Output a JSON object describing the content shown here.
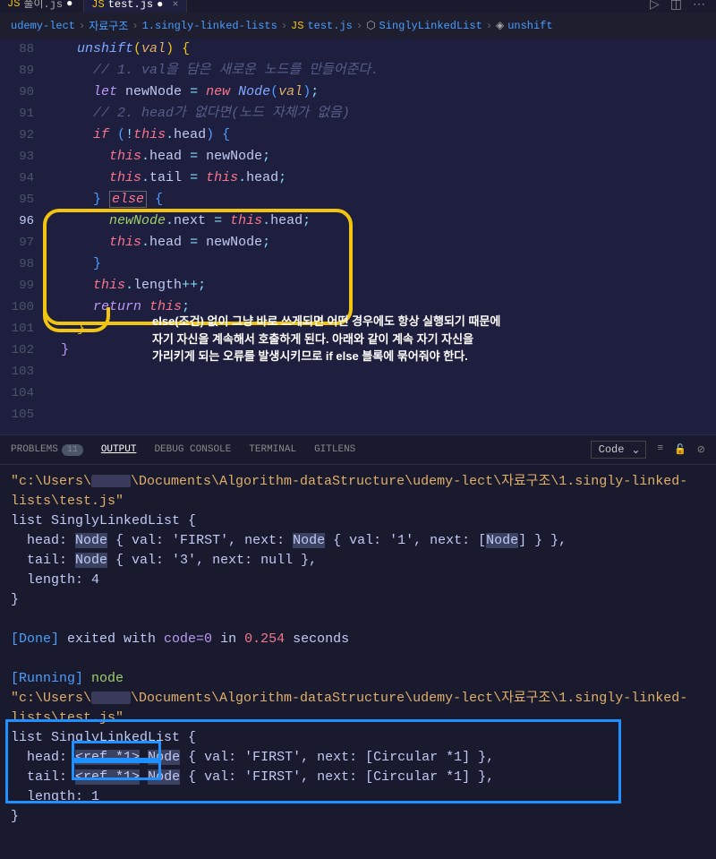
{
  "tabs": {
    "inactive": {
      "name": "풀이.js",
      "modified": "●"
    },
    "active": {
      "name": "test.js",
      "modified": "●",
      "close": "×"
    }
  },
  "breadcrumb": {
    "items": [
      "udemy-lect",
      "자료구조",
      "1.singly-linked-lists",
      "test.js",
      "SinglyLinkedList",
      "unshift"
    ],
    "sep": "›"
  },
  "lines": {
    "88": "88",
    "89": "89",
    "90": "90",
    "91": "91",
    "92": "92",
    "93": "93",
    "94": "94",
    "95": "95",
    "96": "96",
    "97": "97",
    "98": "98",
    "99": "99",
    "100": "100",
    "101": "101",
    "102": "102",
    "103": "103",
    "104": "104",
    "105": "105"
  },
  "code": {
    "l89_fn": "unshift",
    "l89_param": "val",
    "l90_comment": "// 1. val을 담은 새로운 노드를 만들어준다.",
    "l91_let": "let",
    "l91_var": "newNode",
    "l91_new": "new",
    "l91_cls": "Node",
    "l91_param": "val",
    "l92_comment": "// 2. head가 없다면(노드 자체가 없음)",
    "l93_if": "if",
    "l93_this": "this",
    "l93_head": "head",
    "l94_this": "this",
    "l94_head": "head",
    "l94_var": "newNode",
    "l95_this1": "this",
    "l95_tail": "tail",
    "l95_this2": "this",
    "l95_head": "head",
    "l96_else": "else",
    "l97_var": "newNode",
    "l97_next": "next",
    "l97_this": "this",
    "l97_head": "head",
    "l98_this": "this",
    "l98_head": "head",
    "l98_var": "newNode",
    "l101_this": "this",
    "l101_length": "length",
    "l102_return": "return",
    "l102_this": "this"
  },
  "annotation": {
    "line1": "else(조건) 없이 그냥 바로 쓰게되면 어떤 경우에도 항상 실행되기 때문에",
    "line2": "자기 자신을 계속해서 호출하게 된다. 아래와 같이 계속 자기 자신을",
    "line3": "가리키게 되는 오류를 발생시키므로 if else 블록에 묶어줘야 한다."
  },
  "panel": {
    "problems": "PROBLEMS",
    "problems_count": "11",
    "output": "OUTPUT",
    "debug": "DEBUG CONSOLE",
    "terminal": "TERMINAL",
    "gitlens": "GITLENS",
    "dropdown": "Code"
  },
  "terminal": {
    "path_prefix": "\"c:\\Users\\",
    "path_suffix": "\\Documents\\Algorithm-dataStructure\\udemy-lect\\자료구조\\1.singly-linked-lists\\test.js\"",
    "list_header": "list SinglyLinkedList {",
    "head_line_pre": "  head: ",
    "node_text": "Node",
    "head_line_mid": " { val: 'FIRST', next: ",
    "head_line_mid2": " { val: '1', next: [",
    "head_line_end": "] } },",
    "tail_line_pre": "  tail: ",
    "tail_line_body": " { val: '3', next: null },",
    "length_line": "  length: 4",
    "close_brace": "}",
    "done_bracket": "[Done]",
    "done_exited": " exited with ",
    "done_code": "code=0",
    "done_in": " in ",
    "done_time": "0.254",
    "done_seconds": " seconds",
    "running_bracket": "[Running]",
    "running_node": " node ",
    "list2_header": "list SinglyLinkedList {",
    "head2_pre": "  head: ",
    "ref_text": "<ref *1>",
    "head2_body": " { val: 'FIRST', next: [Circular *1] },",
    "tail2_pre": "  tail: ",
    "tail2_body": " { val: 'FIRST', next: [Circular *1] },",
    "length2_line": "  length: 1",
    "close_brace2": "}"
  }
}
